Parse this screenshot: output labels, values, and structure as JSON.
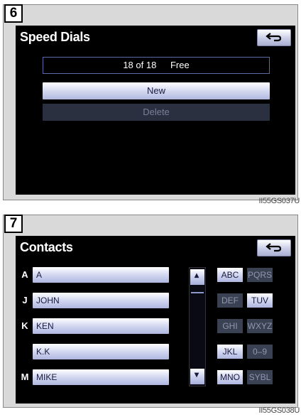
{
  "panel1": {
    "step": "6",
    "figure_code": "II55GS037U",
    "title": "Speed Dials",
    "back_icon": "back-arrow-icon",
    "free_count": "18 of 18",
    "free_label": "Free",
    "new_label": "New",
    "delete_label": "Delete"
  },
  "panel2": {
    "step": "7",
    "figure_code": "II55GS038U",
    "title": "Contacts",
    "back_icon": "back-arrow-icon",
    "contacts": [
      {
        "index": "A",
        "name": "A"
      },
      {
        "index": "J",
        "name": "JOHN"
      },
      {
        "index": "K",
        "name": "KEN"
      },
      {
        "index": "",
        "name": "K.K"
      },
      {
        "index": "M",
        "name": "MIKE"
      }
    ],
    "keys": [
      {
        "label": "ABC",
        "active": true
      },
      {
        "label": "PQRS",
        "active": false
      },
      {
        "label": "DEF",
        "active": false
      },
      {
        "label": "TUV",
        "active": true
      },
      {
        "label": "GHI",
        "active": false
      },
      {
        "label": "WXYZ",
        "active": false
      },
      {
        "label": "JKL",
        "active": true
      },
      {
        "label": "0–9",
        "active": false
      },
      {
        "label": "MNO",
        "active": true
      },
      {
        "label": "SYBL",
        "active": false
      }
    ]
  }
}
